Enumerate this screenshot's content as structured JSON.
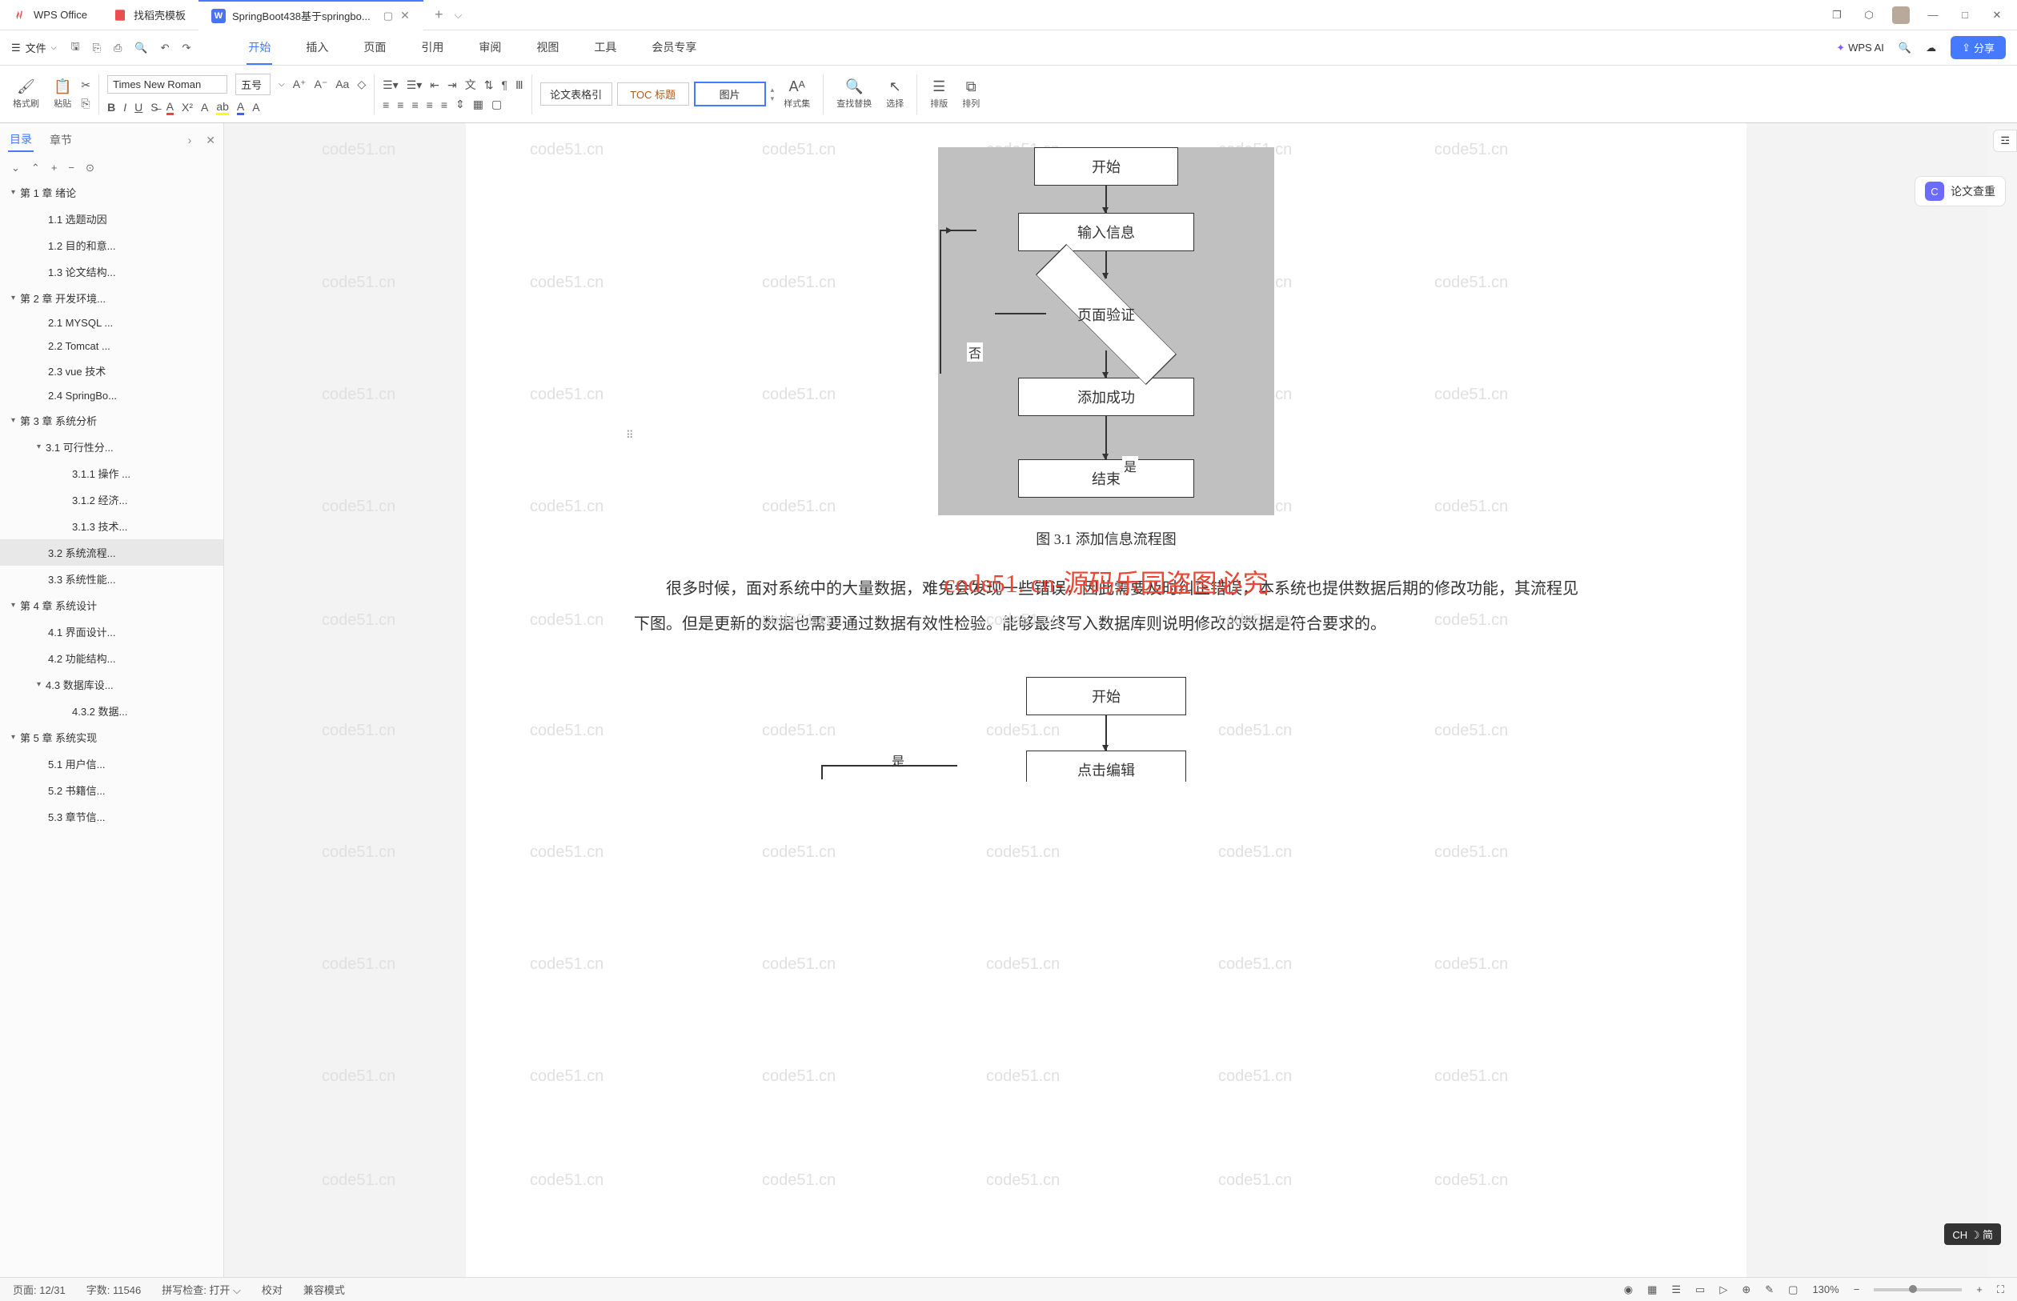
{
  "title_tabs": [
    {
      "icon": "wps",
      "label": "WPS Office"
    },
    {
      "icon": "doc",
      "label": "找稻壳模板"
    },
    {
      "icon": "w",
      "label": "SpringBoot438基于springbo..."
    }
  ],
  "menubar": {
    "file_label": "文件",
    "tabs": [
      "开始",
      "插入",
      "页面",
      "引用",
      "审阅",
      "视图",
      "工具",
      "会员专享"
    ],
    "wps_ai": "WPS AI",
    "share": "分享"
  },
  "ribbon": {
    "format_painter": "格式刷",
    "paste": "粘贴",
    "font_name": "Times New Roman",
    "font_size": "五号",
    "style_group": [
      "论文表格引",
      "TOC 标题",
      "图片"
    ],
    "style_set": "样式集",
    "find_replace": "查找替换",
    "select": "选择",
    "sort_v": "排版",
    "sort_h": "排列"
  },
  "outline": {
    "tabs": [
      "目录",
      "章节"
    ],
    "items": [
      {
        "level": 1,
        "label": "第 1 章  绪论",
        "expand": true
      },
      {
        "level": 2,
        "label": "1.1 选题动因"
      },
      {
        "level": 2,
        "label": "1.2 目的和意..."
      },
      {
        "level": 2,
        "label": "1.3 论文结构..."
      },
      {
        "level": 1,
        "label": "第 2 章  开发环境...",
        "expand": true
      },
      {
        "level": 2,
        "label": "2.1 MYSQL ..."
      },
      {
        "level": 2,
        "label": "2.2 Tomcat ..."
      },
      {
        "level": 2,
        "label": "2.3 vue 技术"
      },
      {
        "level": 2,
        "label": "2.4 SpringBo..."
      },
      {
        "level": 1,
        "label": "第 3 章  系统分析",
        "expand": true
      },
      {
        "level": 2,
        "label": "3.1 可行性分...",
        "expand": true
      },
      {
        "level": 3,
        "label": "3.1.1 操作 ..."
      },
      {
        "level": 3,
        "label": "3.1.2 经济..."
      },
      {
        "level": 3,
        "label": "3.1.3 技术..."
      },
      {
        "level": 2,
        "label": "3.2 系统流程...",
        "selected": true
      },
      {
        "level": 2,
        "label": "3.3 系统性能..."
      },
      {
        "level": 1,
        "label": "第 4 章  系统设计",
        "expand": true
      },
      {
        "level": 2,
        "label": "4.1 界面设计..."
      },
      {
        "level": 2,
        "label": "4.2 功能结构..."
      },
      {
        "level": 2,
        "label": "4.3 数据库设...",
        "expand": true
      },
      {
        "level": 3,
        "label": "4.3.2  数据..."
      },
      {
        "level": 1,
        "label": "第 5 章  系统实现",
        "expand": true
      },
      {
        "level": 2,
        "label": "5.1 用户信..."
      },
      {
        "level": 2,
        "label": "5.2 书籍信..."
      },
      {
        "level": 2,
        "label": "5.3 章节信..."
      }
    ]
  },
  "flowchart1": {
    "start": "开始",
    "input": "输入信息",
    "validate": "页面验证",
    "no": "否",
    "yes": "是",
    "success": "添加成功",
    "end": "结束"
  },
  "overlay_text": "code51. cn-源码乐园盗图必究",
  "caption": "图 3.1  添加信息流程图",
  "paragraph": "很多时候，面对系统中的大量数据，难免会发现一些错误，因此需要及时纠正错误，本系统也提供数据后期的修改功能，其流程见下图。但是更新的数据也需要通过数据有效性检验。能够最终写入数据库则说明修改的数据是符合要求的。",
  "flowchart2": {
    "start": "开始",
    "yes": "是",
    "edit": "点击编辑"
  },
  "right_panel": {
    "paper_check": "论文查重"
  },
  "ime": "CH ☽ 简",
  "watermark": "code51.cn",
  "statusbar": {
    "page": "页面: 12/31",
    "words": "字数: 11546",
    "spelling": "拼写检查: 打开",
    "proof": "校对",
    "compat": "兼容模式",
    "zoom": "130%"
  }
}
